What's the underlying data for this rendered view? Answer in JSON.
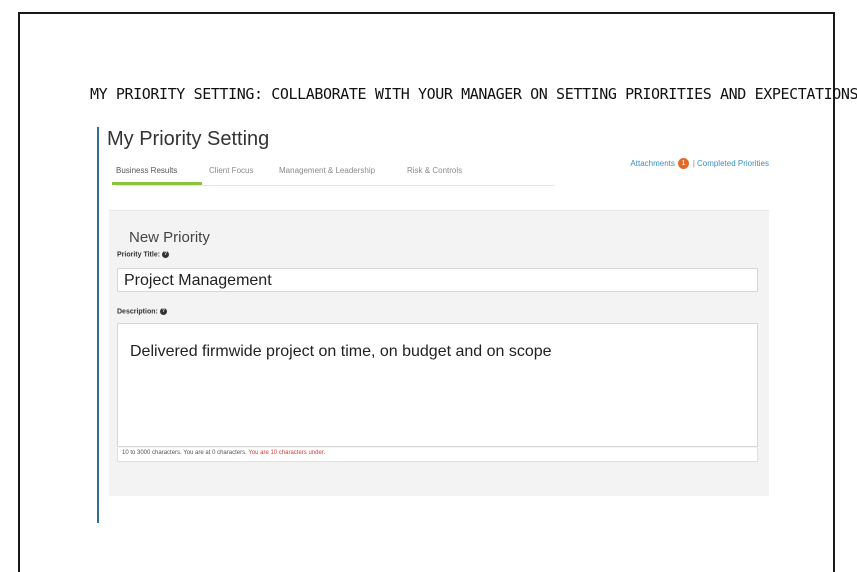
{
  "slide": {
    "heading": "MY PRIORITY SETTING: COLLABORATE WITH YOUR MANAGER ON SETTING PRIORITIES AND EXPECTATIONS"
  },
  "app": {
    "title": "My Priority Setting",
    "tabs": [
      {
        "label": "Business Results",
        "active": true
      },
      {
        "label": "Client Focus",
        "active": false
      },
      {
        "label": "Management & Leadership",
        "active": false
      },
      {
        "label": "Risk & Controls",
        "active": false
      }
    ],
    "links": {
      "attachments_label": "Attachments",
      "attachments_count": "1",
      "separator": "|",
      "completed_label": "Completed Priorities"
    }
  },
  "form": {
    "section_title": "New Priority",
    "priority_title_label": "Priority Title:",
    "priority_title_value": "Project Management",
    "description_label": "Description:",
    "description_value": "Delivered firmwide project on time, on budget and on scope",
    "char_count_text": "10 to 3000 characters. You are at 0 characters.",
    "char_count_warning": "You are 10 characters under."
  },
  "colors": {
    "accent_tab": "#8cc03f",
    "link": "#3a8ec7",
    "badge": "#e46a2b",
    "warning": "#d33c3c",
    "left_bar": "#2f6f8f"
  },
  "icons": {
    "help": "help-circle-icon"
  }
}
